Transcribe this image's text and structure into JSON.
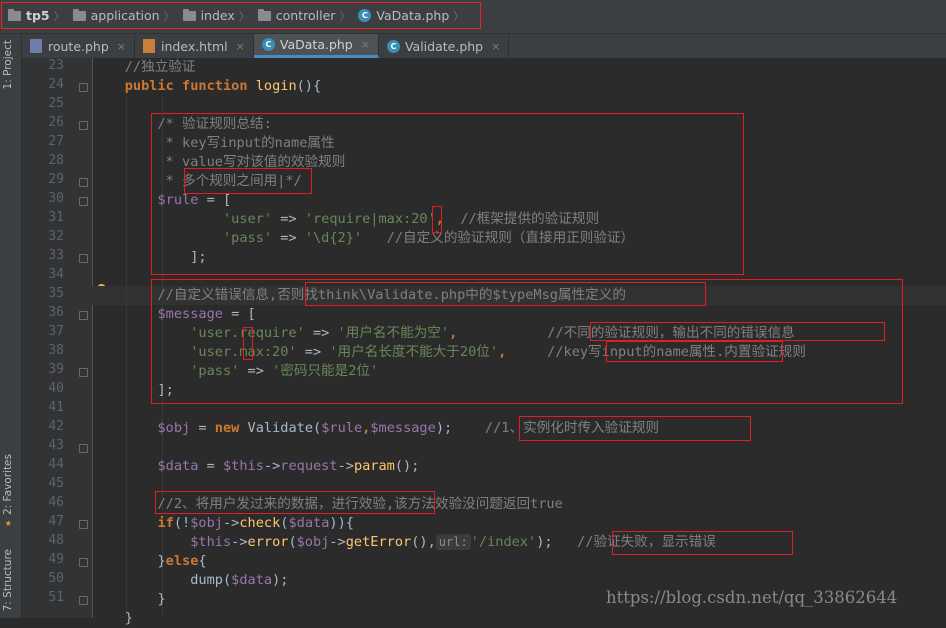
{
  "breadcrumb": [
    {
      "label": "tp5",
      "icon": "folder-icon"
    },
    {
      "label": "application",
      "icon": "folder-icon"
    },
    {
      "label": "index",
      "icon": "folder-icon"
    },
    {
      "label": "controller",
      "icon": "folder-icon"
    },
    {
      "label": "VaData.php",
      "icon": "php-file-icon"
    }
  ],
  "tabs": [
    {
      "label": "route.php",
      "close": "×",
      "icon": "php-file-icon",
      "active": false
    },
    {
      "label": "index.html",
      "close": "×",
      "icon": "html-file-icon",
      "active": false
    },
    {
      "label": "VaData.php",
      "close": "×",
      "icon": "php-file-icon",
      "active": true
    },
    {
      "label": "Validate.php",
      "close": "×",
      "icon": "php-file-icon",
      "active": false
    }
  ],
  "side_tools": {
    "project": "1: Project",
    "favorites": "2: Favorites",
    "structure": "7: Structure"
  },
  "gutter": {
    "line_numbers": [
      "23",
      "24",
      "25",
      "26",
      "27",
      "28",
      "29",
      "30",
      "31",
      "32",
      "33",
      "34",
      "35",
      "36",
      "37",
      "38",
      "39",
      "40",
      "41",
      "42",
      "43",
      "44",
      "45",
      "46",
      "47",
      "48",
      "49",
      "50",
      "51"
    ]
  },
  "colors": {
    "keyword": "#cc7832",
    "comment": "#808080",
    "string": "#6a8759",
    "variable": "#9876aa",
    "method": "#ffc66d",
    "text": "#a9b7c6",
    "annotation_box": "#e02020",
    "background": "#2b2b2b"
  },
  "code": {
    "l23": {
      "t0": "    //独立验证"
    },
    "l24": {
      "t0": "    ",
      "t1": "public function ",
      "t2": "login",
      "t3": "(){"
    },
    "l26": {
      "t0": "        /* 验证规则总结:"
    },
    "l27": {
      "t0": "         * key写input的name属性"
    },
    "l28": {
      "t0": "         * value写对该值的效验规则"
    },
    "l29": {
      "t0": "         * ",
      "t1": "多个规则之间用|",
      "t2": "*/"
    },
    "l30": {
      "t0": "        ",
      "t1": "$rule",
      " t2": "",
      "t3": " = ["
    },
    "l31": {
      "t0": "                ",
      "t1": "'user'",
      " t2": "",
      "t3": " => ",
      "t4": "'require|max:20'",
      "t5": ",  ",
      "t6": "//框架提供的验证规则"
    },
    "l32": {
      "t0": "                ",
      "t1": "'pass'",
      "t3": " => ",
      "t4": "'\\d{2}'",
      "t5": "   ",
      "t6": "//自定义的验证规则（直接用正则验证）"
    },
    "l33": {
      "t0": "            ];"
    },
    "l35": {
      "t0": "        ",
      "t1": "//自定义错误信息,否则找think\\Validate.php中的$typeMsg属性定义的"
    },
    "l36": {
      "t0": "        ",
      "t1": "$message",
      "t2": " = ["
    },
    "l37": {
      "t0": "            ",
      "t1": "'user.require'",
      "t2": " => ",
      "t3": "'用户名不能为空'",
      "t4": ",           ",
      "t5": "//不同的验证规则，输出不同的错误信息"
    },
    "l38": {
      "t0": "            ",
      "t1": "'user.max:20'",
      "t2": " => ",
      "t3": "'用户名长度不能大于20位'",
      "t4": ",     ",
      "t5": "//key写input的name属性.内置验证规则"
    },
    "l39": {
      "t0": "            ",
      "t1": "'pass'",
      "t2": " => ",
      "t3": "'密码只能是2位'"
    },
    "l40": {
      "t0": "        ];"
    },
    "l42": {
      "t0": "        ",
      "t1": "$obj",
      "t2": " = ",
      "t3": "new ",
      "t4": "Validate(",
      "t5": "$rule",
      ",": ",",
      "t6": ",",
      "t7": "$message",
      "t8": ");    ",
      "t9": "//1、实例化时传入验证规则"
    },
    "l44": {
      "t0": "        ",
      "t1": "$data",
      "t2": " = ",
      "t3": "$this",
      "t4": "->",
      "t5": "request",
      "t6": "->",
      "t7": "param",
      "t8": "();"
    },
    "l46": {
      "t0": "        ",
      "t1": "//2、将用户发过来的数据，进行效验,该方法效验没问题返回true"
    },
    "l47": {
      "t0": "        ",
      "t1": "if",
      "t2": "(!",
      "t3": "$obj",
      "t4": "->",
      "t5": "check",
      "t6": "(",
      "t7": "$data",
      "t8": ")){"
    },
    "l48": {
      "t0": "            ",
      "t1": "$this",
      "t2": "->",
      "t3": "error",
      "t4": "(",
      "t5": "$obj",
      "t6": "->",
      "t7": "getError",
      "t8": "(),",
      "t9": "url:",
      "t10": "'/index'",
      "t11": ");   ",
      "t12": "//验证失败，显示错误"
    },
    "l49": {
      "t0": "        }",
      "t1": "else",
      "t2": "{"
    },
    "l50": {
      "t0": "            ",
      "t1": "dump",
      "t2": "(",
      "t3": "$data",
      "t4": ");"
    },
    "l51": {
      "t0": "        }"
    },
    "l52": {
      "t0": "    }"
    }
  },
  "watermark": "https://blog.csdn.net/qq_33862644"
}
